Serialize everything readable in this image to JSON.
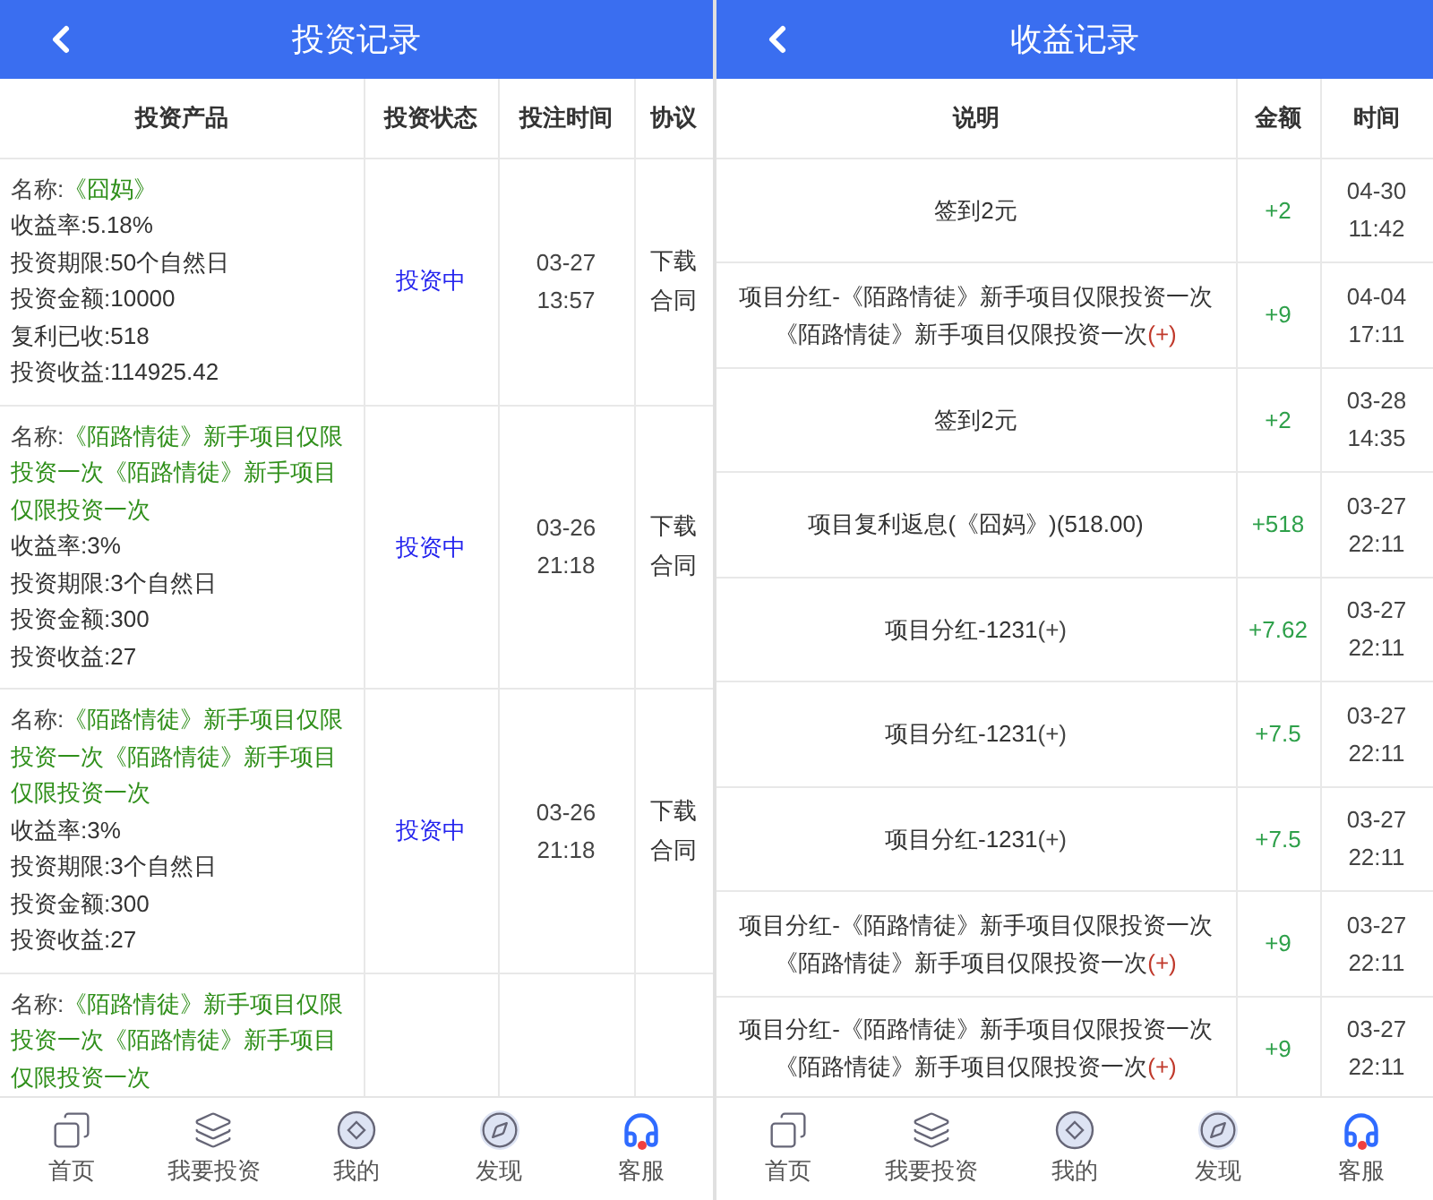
{
  "left": {
    "header": {
      "title": "投资记录"
    },
    "columns": [
      "投资产品",
      "投资状态",
      "投注时间",
      "协议"
    ],
    "rows": [
      {
        "name_label": "名称:",
        "name": "《囧妈》",
        "details": [
          "收益率:5.18%",
          "投资期限:50个自然日",
          "投资金额:10000",
          "复利已收:518",
          "投资收益:114925.42"
        ],
        "status": "投资中",
        "date": "03-27",
        "clock": "13:57",
        "agreement": "下载合同"
      },
      {
        "name_label": "名称:",
        "name": "《陌路情徒》新手项目仅限投资一次《陌路情徒》新手项目仅限投资一次",
        "details": [
          "收益率:3%",
          "投资期限:3个自然日",
          "投资金额:300",
          "投资收益:27"
        ],
        "status": "投资中",
        "date": "03-26",
        "clock": "21:18",
        "agreement": "下载合同"
      },
      {
        "name_label": "名称:",
        "name": "《陌路情徒》新手项目仅限投资一次《陌路情徒》新手项目仅限投资一次",
        "details": [
          "收益率:3%",
          "投资期限:3个自然日",
          "投资金额:300",
          "投资收益:27"
        ],
        "status": "投资中",
        "date": "03-26",
        "clock": "21:18",
        "agreement": "下载合同"
      },
      {
        "name_label": "名称:",
        "name": "《陌路情徒》新手项目仅限投资一次《陌路情徒》新手项目仅限投资一次"
      }
    ],
    "tabbar": [
      {
        "label": "首页",
        "kind": "home"
      },
      {
        "label": "我要投资",
        "kind": "invest"
      },
      {
        "label": "我的",
        "kind": "mine"
      },
      {
        "label": "发现",
        "kind": "discover"
      },
      {
        "label": "客服",
        "kind": "service"
      }
    ]
  },
  "right": {
    "header": {
      "title": "收益记录"
    },
    "columns": [
      "说明",
      "金额",
      "时间"
    ],
    "rows": [
      {
        "text": "签到2元",
        "amount": "+2",
        "date": "04-30",
        "clock": "11:42"
      },
      {
        "text": "项目分红-《陌路情徒》新手项目仅限投资一次《陌路情徒》新手项目仅限投资一次",
        "suffix": "(+)",
        "suffix_red": true,
        "amount": "+9",
        "date": "04-04",
        "clock": "17:11"
      },
      {
        "text": "签到2元",
        "amount": "+2",
        "date": "03-28",
        "clock": "14:35"
      },
      {
        "text": "项目复利返息(《囧妈》)(518.00)",
        "amount": "+518",
        "date": "03-27",
        "clock": "22:11"
      },
      {
        "text": "项目分红-1231",
        "suffix": "(+)",
        "suffix_red": false,
        "amount": "+7.62",
        "date": "03-27",
        "clock": "22:11"
      },
      {
        "text": "项目分红-1231",
        "suffix": "(+)",
        "suffix_red": false,
        "amount": "+7.5",
        "date": "03-27",
        "clock": "22:11"
      },
      {
        "text": "项目分红-1231",
        "suffix": "(+)",
        "suffix_red": false,
        "amount": "+7.5",
        "date": "03-27",
        "clock": "22:11"
      },
      {
        "text": "项目分红-《陌路情徒》新手项目仅限投资一次《陌路情徒》新手项目仅限投资一次",
        "suffix": "(+)",
        "suffix_red": true,
        "amount": "+9",
        "date": "03-27",
        "clock": "22:11"
      },
      {
        "text": "项目分红-《陌路情徒》新手项目仅限投资一次《陌路情徒》新手项目仅限投资一次",
        "suffix": "(+)",
        "suffix_red": true,
        "amount": "+9",
        "date": "03-27",
        "clock": "22:11"
      }
    ],
    "tabbar": [
      {
        "label": "首页",
        "kind": "home"
      },
      {
        "label": "我要投资",
        "kind": "invest"
      },
      {
        "label": "我的",
        "kind": "mine"
      },
      {
        "label": "发现",
        "kind": "discover"
      },
      {
        "label": "客服",
        "kind": "service"
      }
    ]
  }
}
